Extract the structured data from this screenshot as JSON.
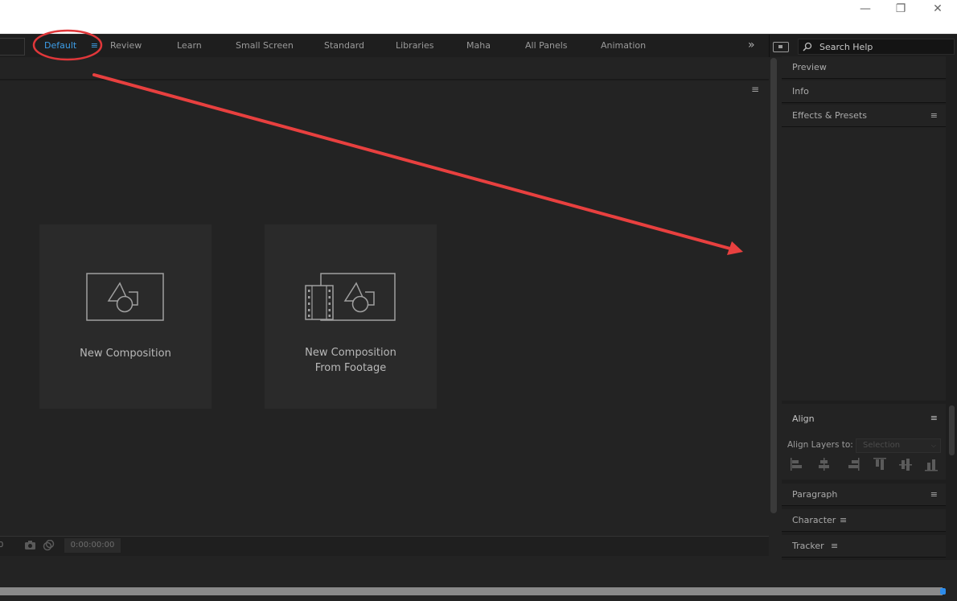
{
  "window_controls": {
    "minimize": "—",
    "restore": "❐",
    "close": "✕"
  },
  "workspaces": {
    "items": [
      {
        "label": "Default"
      },
      {
        "label": "Review"
      },
      {
        "label": "Learn"
      },
      {
        "label": "Small Screen"
      },
      {
        "label": "Standard"
      },
      {
        "label": "Libraries"
      },
      {
        "label": "Maha"
      },
      {
        "label": "All Panels"
      },
      {
        "label": "Animation"
      }
    ],
    "active": "Default",
    "menu_icon": "≡",
    "overflow_icon": "»"
  },
  "search": {
    "placeholder": "Search Help",
    "icon": "search-icon"
  },
  "composition_panel": {
    "menu_icon": "≡",
    "cards": [
      {
        "label_line1": "New Composition",
        "label_line2": ""
      },
      {
        "label_line1": "New Composition",
        "label_line2": "From Footage"
      }
    ],
    "footer": {
      "frame_value": "0",
      "timecode": "0:00:00:00"
    }
  },
  "right_panels": {
    "tabs": [
      {
        "label": "Preview"
      },
      {
        "label": "Info"
      },
      {
        "label": "Effects & Presets",
        "menu": "≡"
      },
      {
        "label": "Paragraph",
        "menu": "≡"
      },
      {
        "label": "Character",
        "menu": "≡"
      },
      {
        "label": "Tracker",
        "menu": "≡"
      }
    ],
    "align": {
      "title": "Align",
      "menu": "≡",
      "align_layers_to_label": "Align Layers to:",
      "align_to_value": "Selection"
    }
  },
  "annotation": {
    "circle_color": "#e0373a",
    "arrow_color": "#e8403f"
  },
  "colors": {
    "accent": "#3d9ee8",
    "panel_bg": "#232323"
  }
}
